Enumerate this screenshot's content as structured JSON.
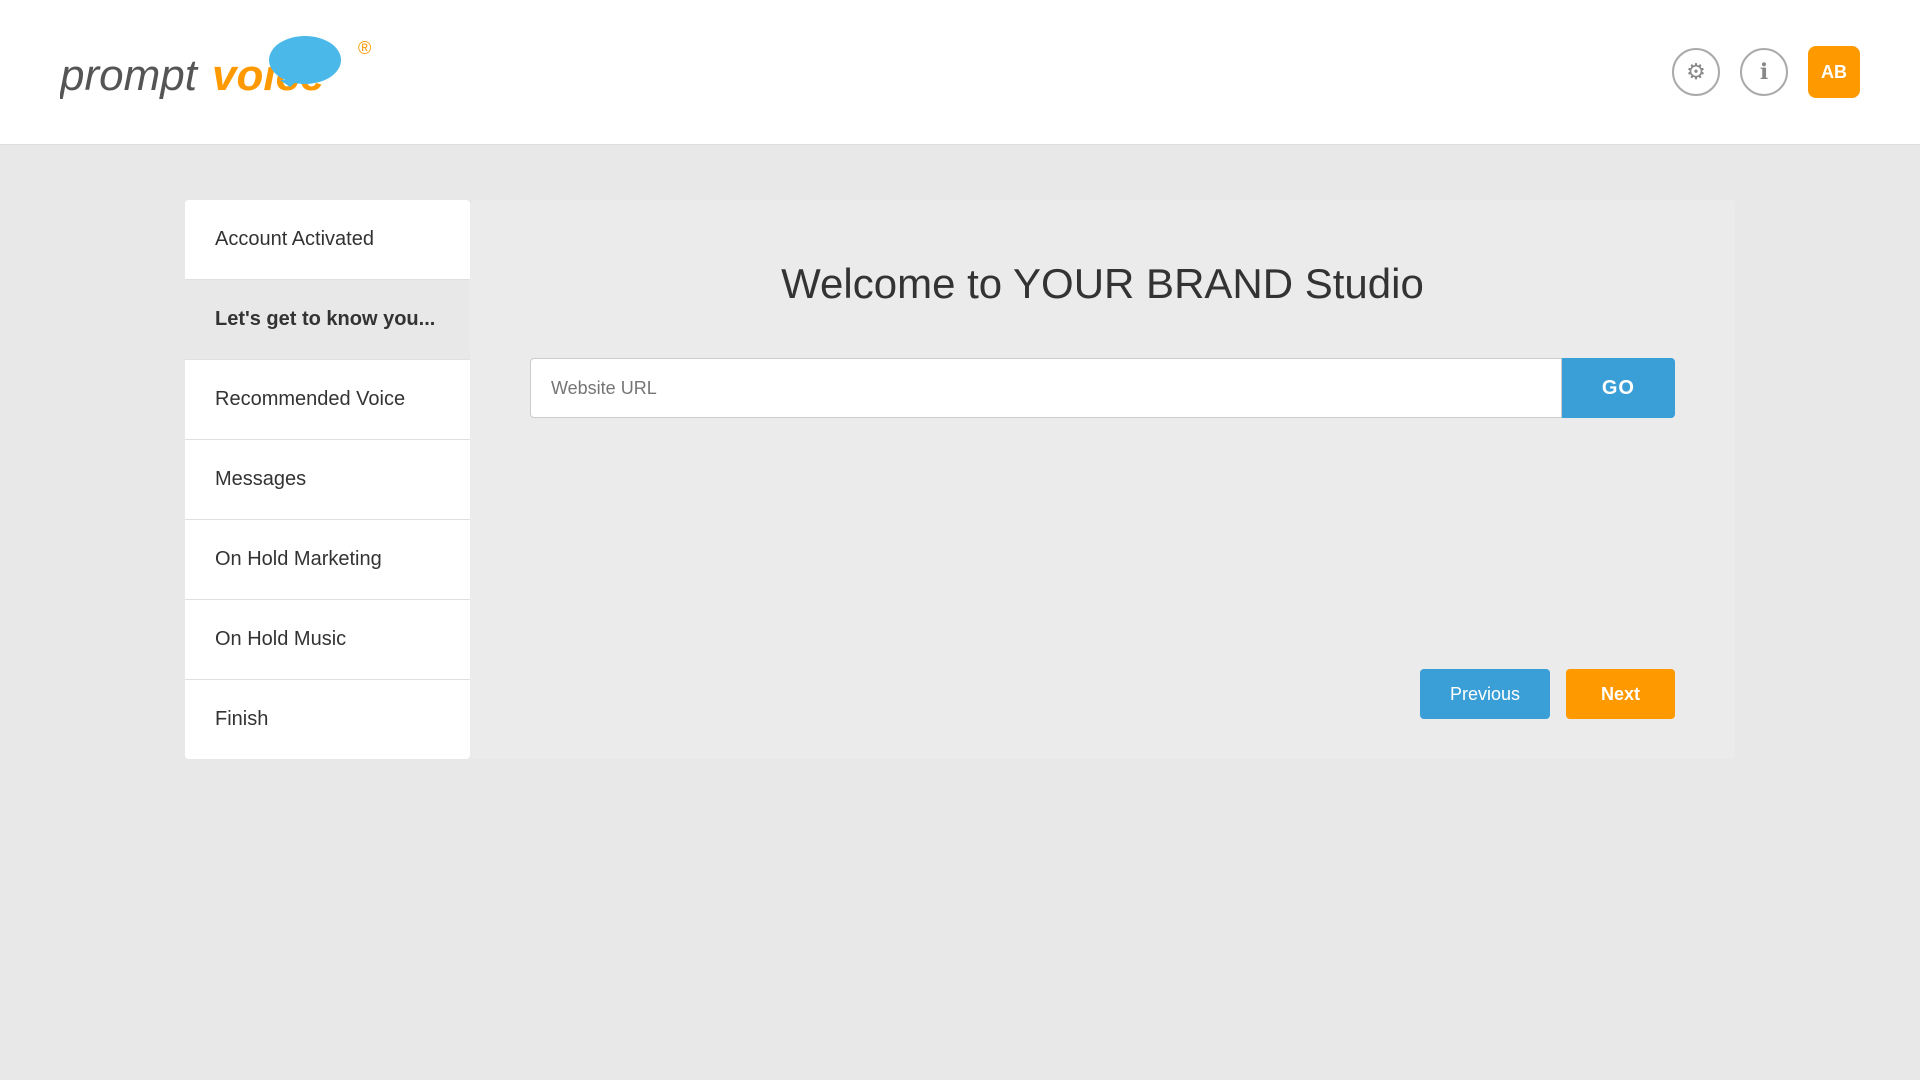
{
  "header": {
    "logo": {
      "text_prompt": "prompt",
      "text_voice": "voice",
      "registered": "®"
    },
    "icons": {
      "settings": "⚙",
      "info": "ℹ",
      "avatar": "AB"
    }
  },
  "sidebar": {
    "items": [
      {
        "id": "account-activated",
        "label": "Account Activated",
        "active": false
      },
      {
        "id": "lets-get-to-know-you",
        "label": "Let's get to know you...",
        "active": true
      },
      {
        "id": "recommended-voice",
        "label": "Recommended Voice",
        "active": false
      },
      {
        "id": "messages",
        "label": "Messages",
        "active": false
      },
      {
        "id": "on-hold-marketing",
        "label": "On Hold Marketing",
        "active": false
      },
      {
        "id": "on-hold-music",
        "label": "On Hold Music",
        "active": false
      },
      {
        "id": "finish",
        "label": "Finish",
        "active": false
      }
    ]
  },
  "content": {
    "title": "Welcome to YOUR BRAND Studio",
    "url_placeholder": "Website URL",
    "go_button": "GO",
    "previous_button": "Previous",
    "next_button": "Next"
  }
}
